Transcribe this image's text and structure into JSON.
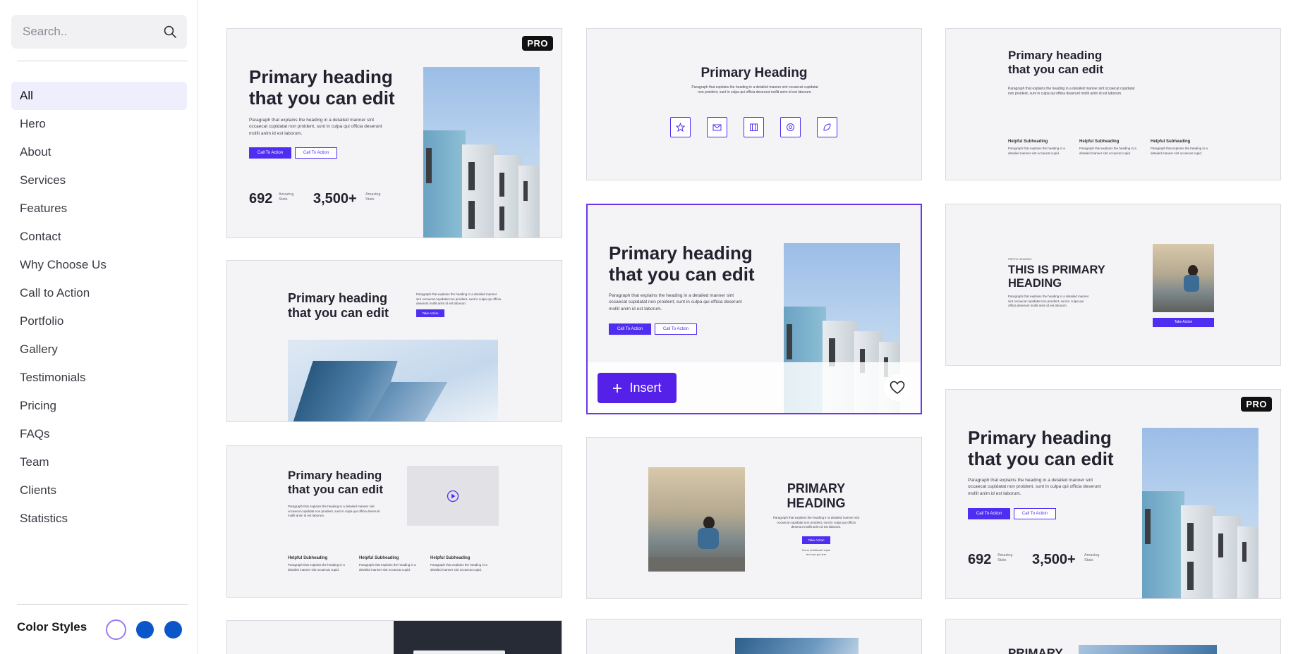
{
  "sidebar": {
    "search_placeholder": "Search..",
    "items": [
      {
        "label": "All"
      },
      {
        "label": "Hero"
      },
      {
        "label": "About"
      },
      {
        "label": "Services"
      },
      {
        "label": "Features"
      },
      {
        "label": "Contact"
      },
      {
        "label": "Why Choose Us"
      },
      {
        "label": "Call to Action"
      },
      {
        "label": "Portfolio"
      },
      {
        "label": "Gallery"
      },
      {
        "label": "Testimonials"
      },
      {
        "label": "Pricing"
      },
      {
        "label": "FAQs"
      },
      {
        "label": "Team"
      },
      {
        "label": "Clients"
      },
      {
        "label": "Statistics"
      }
    ],
    "color_styles_label": "Color Styles",
    "swatches": [
      "#ffffff",
      "#0b57c9",
      "#0b57c9"
    ]
  },
  "cards": {
    "pro_badge": "PRO",
    "hero_heading_line1": "Primary heading",
    "hero_heading_line2": "that you can edit",
    "hero_paragraph": "Paragraph that explains the heading in a detailed manner sint occaecat cupidatat non proident, sunt in culpa qui officia deserunt mollit anim id est laborum.",
    "cta_primary": "Call To Action",
    "cta_secondary": "Call To Action",
    "take_action": "Take Action",
    "stat1_value": "692",
    "stat2_value": "3,500+",
    "stat_label_line1": "Amazing",
    "stat_label_line2": "Stats",
    "center_heading": "Primary Heading",
    "center_paragraph": "Paragraph that explains the heading in a detailed manner sint occaecat cupidatat non proident, sunt in culpa qui officia deserunt mollit anim id est laborum.",
    "helpful_subheading": "Helpful Subheading",
    "helpful_paragraph": "Paragraph that explains the heading in a detailed manner sint occaecat cupid.",
    "upper_heading_line1": "THIS IS PRIMARY",
    "upper_heading_line2": "HEADING",
    "proto_heading": "PROTO HEADING",
    "primary_heading_upper_line1": "PRIMARY",
    "primary_heading_upper_line2": "HEADING",
    "small_note_line1": "Some additional helper",
    "small_note_line2": "text can go here",
    "primary_partial": "PRIMARY",
    "insert_label": "Insert"
  },
  "colors": {
    "accent": "#4f2ef2",
    "selected_border": "#6b37e8",
    "active_nav_bg": "#efeefc"
  }
}
